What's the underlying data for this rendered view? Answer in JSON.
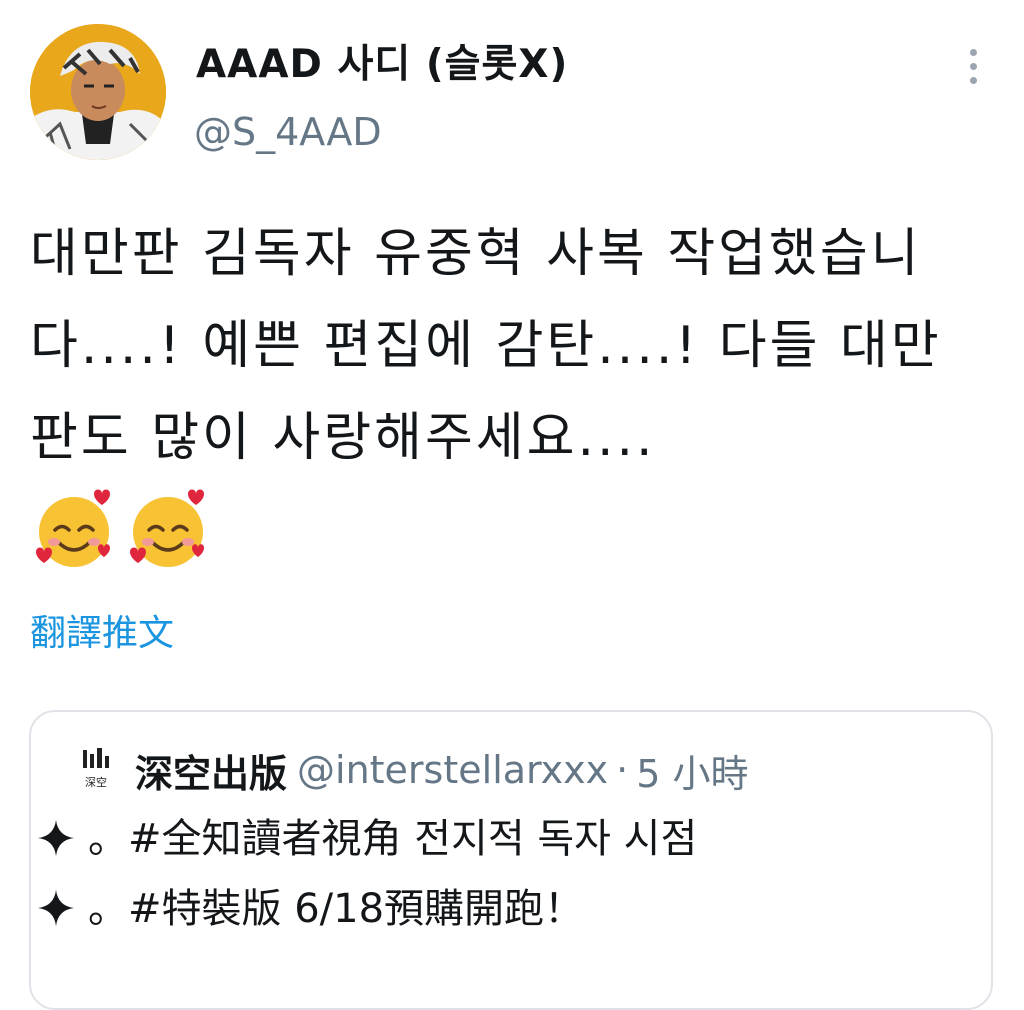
{
  "author": {
    "display_name": "AAAD 사디 (슬롯X)",
    "handle": "@S_4AAD"
  },
  "tweet": {
    "text": "대만판 김독자 유중혁 사복 작업했습니다....! 예쁜 편집에 감탄....! 다들 대만판도 많이 사랑해주세요....",
    "emojis": [
      "smiling-face-with-hearts",
      "smiling-face-with-hearts"
    ],
    "translate_label": "翻譯推文"
  },
  "quoted": {
    "logo_text": "深空",
    "name": "深空出版",
    "handle": "@interstellarxxx",
    "separator": "·",
    "time": "5 小時",
    "lines": [
      "。#全知讀者視角 전지적 독자 시점",
      "。#特裝版 6/18預購開跑！"
    ]
  },
  "colors": {
    "link": "#1b95e0",
    "muted": "#657786",
    "border": "#dfe3e7",
    "avatar_bg": "#e9a71b"
  }
}
